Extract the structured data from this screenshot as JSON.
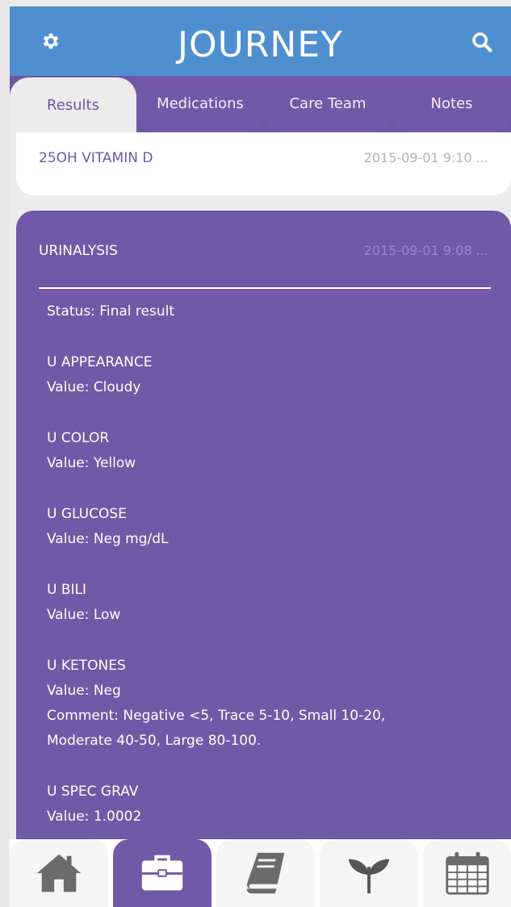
{
  "header": {
    "title": "JOURNEY"
  },
  "tabs": [
    {
      "label": "Results",
      "active": true
    },
    {
      "label": "Medications",
      "active": false
    },
    {
      "label": "Care Team",
      "active": false
    },
    {
      "label": "Notes",
      "active": false
    }
  ],
  "results": [
    {
      "name": "25OH VITAMIN D",
      "timestamp": "2015-09-01 9:10 ..."
    },
    {
      "name": "URINALYSIS",
      "timestamp": "2015-09-01 9:08 ...",
      "status": "Status: Final result",
      "items": [
        {
          "title": "U APPEARANCE",
          "value": "Value: Cloudy"
        },
        {
          "title": "U COLOR",
          "value": "Value: Yellow"
        },
        {
          "title": "U GLUCOSE",
          "value": "Value: Neg mg/dL"
        },
        {
          "title": "U BILI",
          "value": "Value: Low"
        },
        {
          "title": "U KETONES",
          "value": "Value: Neg",
          "comment1": "Comment: Negative <5, Trace 5-10, Small 10-20,",
          "comment2": "Moderate 40-50, Large 80-100."
        },
        {
          "title": "U SPEC GRAV",
          "value": "Value: 1.0002"
        }
      ]
    }
  ],
  "bottom_nav": [
    {
      "icon": "home-icon",
      "active": false
    },
    {
      "icon": "briefcase-icon",
      "active": true
    },
    {
      "icon": "book-icon",
      "active": false
    },
    {
      "icon": "plant-icon",
      "active": false
    },
    {
      "icon": "calendar-icon",
      "active": false
    }
  ],
  "colors": {
    "header": "#4f8fd0",
    "accent": "#7059a6",
    "background": "#ececec"
  }
}
